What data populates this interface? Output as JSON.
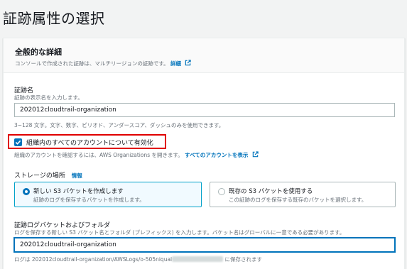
{
  "page": {
    "title": "証跡属性の選択"
  },
  "general": {
    "title": "全般的な詳細",
    "description": "コンソールで作成された証跡は、マルチリージョンの証跡です。",
    "details_link": "詳細"
  },
  "trail_name": {
    "label": "証跡名",
    "hint": "証跡の表示名を入力します。",
    "value": "202012cloudtrail-organization",
    "constraint": "3~128 文字。文字、数字、ピリオド、アンダースコア、ダッシュのみを使用できます。"
  },
  "org_checkbox": {
    "label": "組織内のすべてのアカウントについて有効化",
    "checked": true,
    "hint": "組織のアカウントを確認するには、AWS Organizations を開きます。",
    "link": "すべてのアカウントを表示"
  },
  "storage": {
    "label": "ストレージの場所",
    "info": "情報",
    "options": [
      {
        "title": "新しい S3 バケットを作成します",
        "desc": "証跡のログを保存するバケットを作成します。",
        "selected": true
      },
      {
        "title": "既存の S3 バケットを使用する",
        "desc": "この証跡のログを保存する既存のバケットを選択します。",
        "selected": false
      }
    ]
  },
  "bucket": {
    "label": "証跡ログバケットおよびフォルダ",
    "hint": "ログを保存する新しい S3 バケット名とフォルダ (プレフィックス) を入力します。バケット名はグローバルに一意である必要があります。",
    "value": "202012cloudtrail-organization",
    "path_prefix": "ログは 202012cloudtrail-organization/AWSLogs/o-505niqual",
    "path_suffix": "に保存されます"
  },
  "colors": {
    "link": "#0073bb",
    "highlight": "#e00000",
    "selected_border": "#00a1c9"
  },
  "icons": [
    "external-link-icon",
    "checkmark-icon"
  ]
}
